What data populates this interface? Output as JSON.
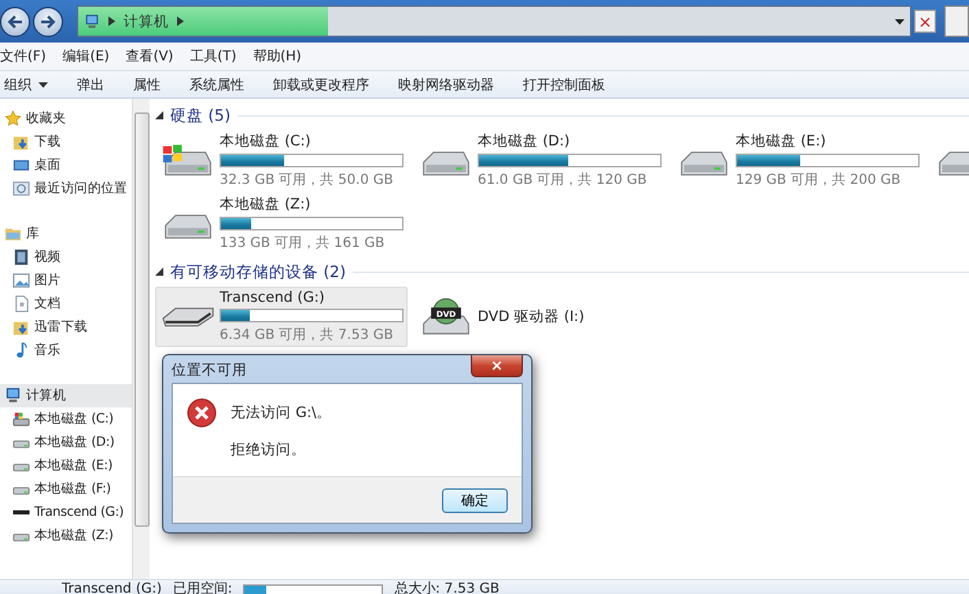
{
  "address_bar": {
    "crumbs": [
      "计算机"
    ],
    "level": 0.3,
    "stop_label": "×"
  },
  "menu_bar": [
    "文件(F)",
    "编辑(E)",
    "查看(V)",
    "工具(T)",
    "帮助(H)"
  ],
  "toolbar": [
    {
      "label": "组织",
      "kind": "dropdown"
    },
    {
      "label": "弹出",
      "kind": "button"
    },
    {
      "label": "属性",
      "kind": "button"
    },
    {
      "label": "系统属性",
      "kind": "button"
    },
    {
      "label": "卸载或更改程序",
      "kind": "button"
    },
    {
      "label": "映射网络驱动器",
      "kind": "button"
    },
    {
      "label": "打开控制面板",
      "kind": "button"
    }
  ],
  "sidebar": {
    "groups": [
      {
        "label": "收藏夹",
        "kind": "star",
        "selected": false,
        "children": [
          {
            "label": "下载",
            "kind": "download",
            "selected": false
          },
          {
            "label": "桌面",
            "kind": "desktop",
            "selected": false
          },
          {
            "label": "最近访问的位置",
            "kind": "recent",
            "selected": false
          }
        ]
      },
      {
        "label": "库",
        "kind": "library",
        "selected": false,
        "children": [
          {
            "label": "视频",
            "kind": "video",
            "selected": false
          },
          {
            "label": "图片",
            "kind": "picture",
            "selected": false
          },
          {
            "label": "文档",
            "kind": "document",
            "selected": false
          },
          {
            "label": "迅雷下载",
            "kind": "download",
            "selected": false
          },
          {
            "label": "音乐",
            "kind": "music",
            "selected": false
          }
        ]
      },
      {
        "label": "计算机",
        "kind": "computer",
        "selected": true,
        "children": [
          {
            "label": "本地磁盘 (C:)",
            "kind": "os",
            "selected": false
          },
          {
            "label": "本地磁盘 (D:)",
            "kind": "hdd",
            "selected": false
          },
          {
            "label": "本地磁盘 (E:)",
            "kind": "hdd",
            "selected": false
          },
          {
            "label": "本地磁盘 (F:)",
            "kind": "hdd",
            "selected": false
          },
          {
            "label": "Transcend (G:)",
            "kind": "usb",
            "selected": false
          },
          {
            "label": "本地磁盘 (Z:)",
            "kind": "hdd",
            "selected": false
          }
        ]
      }
    ]
  },
  "sections": [
    {
      "title": "硬盘 (5)",
      "expanded": true,
      "drives": [
        {
          "name": "本地磁盘 (C:)",
          "kind": "os",
          "level": 0.35,
          "info": "32.3 GB 可用，共 50.0 GB",
          "selected": false
        },
        {
          "name": "本地磁盘 (D:)",
          "kind": "hdd",
          "level": 0.49,
          "info": "61.0 GB 可用，共 120 GB",
          "selected": false
        },
        {
          "name": "本地磁盘 (E:)",
          "kind": "hdd",
          "level": 0.35,
          "info": "129 GB 可用，共 200 GB",
          "selected": false
        },
        {
          "kind": "hdd",
          "selected": false
        },
        {
          "name": "本地磁盘 (Z:)",
          "kind": "hdd",
          "level": 0.17,
          "info": "133 GB 可用，共 161 GB",
          "selected": false
        }
      ]
    },
    {
      "title": "有可移动存储的设备 (2)",
      "expanded": true,
      "drives": [
        {
          "name": "Transcend (G:)",
          "kind": "usb",
          "level": 0.16,
          "info": "6.34 GB 可用，共 7.53 GB",
          "selected": true
        },
        {
          "name": "DVD 驱动器 (I:)",
          "kind": "dvd",
          "icon_label": "DVD",
          "selected": false
        }
      ]
    }
  ],
  "status_bar": {
    "name": "Transcend (G:)",
    "used_label": "已用空间:",
    "level": 0.16,
    "total": "总大小: 7.53 GB"
  },
  "dialog": {
    "title": "位置不可用",
    "close_label": "×",
    "messages": [
      "无法访问 G:\\。",
      "拒绝访问。"
    ],
    "buttons": [
      "确定"
    ]
  }
}
